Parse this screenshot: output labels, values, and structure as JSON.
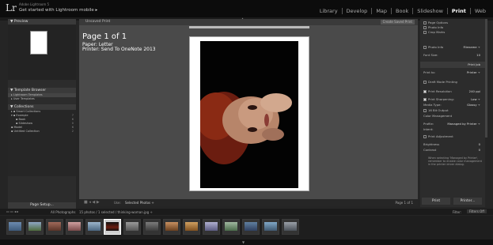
{
  "topbar": {
    "logo": "Lr",
    "app_name": "Adobe Lightroom 5",
    "mobile_cta": "Get started with Lightroom mobile ▸",
    "modules": [
      "Library",
      "Develop",
      "Map",
      "Book",
      "Slideshow",
      "Print",
      "Web"
    ],
    "active_module": "Print"
  },
  "left_panel": {
    "preview_label": "Preview",
    "template_browser_label": "Template Browser",
    "templates": [
      "Lightroom Templates",
      "User Templates"
    ],
    "collections_label": "Collections",
    "collections": [
      {
        "name": "Smart Collections",
        "count": ""
      },
      {
        "name": "Example",
        "count": "7"
      },
      {
        "name": "Book",
        "count": "6"
      },
      {
        "name": "Slideshow",
        "count": "0"
      },
      {
        "name": "Model",
        "count": "6"
      },
      {
        "name": "Untitled Collection",
        "count": "2"
      }
    ],
    "page_setup_label": "Page Setup..."
  },
  "center": {
    "unsaved_label": "Unsaved Print",
    "create_saved_label": "Create Saved Print",
    "page_info": "Page 1 of 1",
    "paper_info": "Paper: Letter",
    "printer_info": "Printer: Send To OneNote 2013",
    "use_label": "Use:",
    "use_value": "Selected Photos ÷",
    "page_count": "Page 1 of 1"
  },
  "right_panel": {
    "rows": [
      {
        "label": "Page Options",
        "value": ""
      },
      {
        "label": "Photo Info",
        "value": ""
      },
      {
        "label": "Crop Marks",
        "value": ""
      },
      {
        "label": "Photo Info",
        "value": "Filename ÷"
      },
      {
        "label": "Font Size:",
        "value": "10"
      },
      {
        "label": "Print Job",
        "value": ""
      },
      {
        "label": "Print to:",
        "value": "Printer ÷"
      },
      {
        "label": "Draft Mode Printing",
        "value": ""
      },
      {
        "label": "Print Resolution",
        "value": "240 ppi"
      },
      {
        "label": "Print Sharpening:",
        "value": "Low ÷"
      },
      {
        "label": "Media Type:",
        "value": "Glossy ÷"
      },
      {
        "label": "16 Bit Output",
        "value": ""
      },
      {
        "label": "Color Management",
        "value": ""
      },
      {
        "label": "Profile:",
        "value": "Managed by Printer ÷"
      },
      {
        "label": "Intent:",
        "value": "Perceptual"
      },
      {
        "label": "Print Adjustment",
        "value": ""
      },
      {
        "label": "Brightness",
        "value": "0"
      },
      {
        "label": "Contrast",
        "value": "0"
      },
      {
        "label": "When selecting 'Managed by Printer', remember to enable color management in the printer driver dialog.",
        "value": ""
      }
    ],
    "print_label": "Print",
    "printer_label": "Printer..."
  },
  "filmbar": {
    "source": "All Photographs",
    "status": "15 photos / 1 selected / thinking-woman.jpg ÷",
    "filter_label": "Filter:",
    "filter_value": "Filters Off"
  },
  "accent": "#ffffff",
  "selected_thumb_index": 5
}
